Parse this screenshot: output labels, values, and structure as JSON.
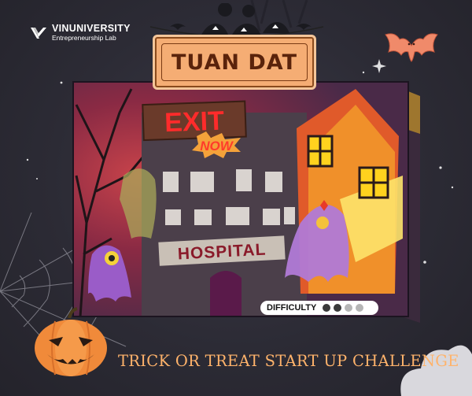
{
  "brand": {
    "name": "VINUNIVERSITY",
    "subtitle": "Entrepreneurship Lab",
    "logo_icon": "vinuni-logo-icon"
  },
  "name_plate": {
    "text": "TUAN DAT"
  },
  "box_art": {
    "exit_sign": "EXIT",
    "exit_badge": "NOW",
    "building_sign": "HOSPITAL"
  },
  "difficulty": {
    "label": "DIFFICULTY",
    "level": 2,
    "max": 4,
    "colors": {
      "filled": "#3a3a3a",
      "empty": "#b5b5b5"
    }
  },
  "footer": {
    "challenge_title": "TRICK OR TREAT START UP CHALLENGE"
  },
  "colors": {
    "background": "#2c2b35",
    "plate": "#f5ad74",
    "title_orange": "#ffb36b",
    "bat": "#f08a6a"
  },
  "icons": [
    "bat-icon",
    "pumpkin-icon",
    "spiderweb-icon",
    "ghost-icon",
    "bat-garland-icon",
    "star-icon"
  ]
}
